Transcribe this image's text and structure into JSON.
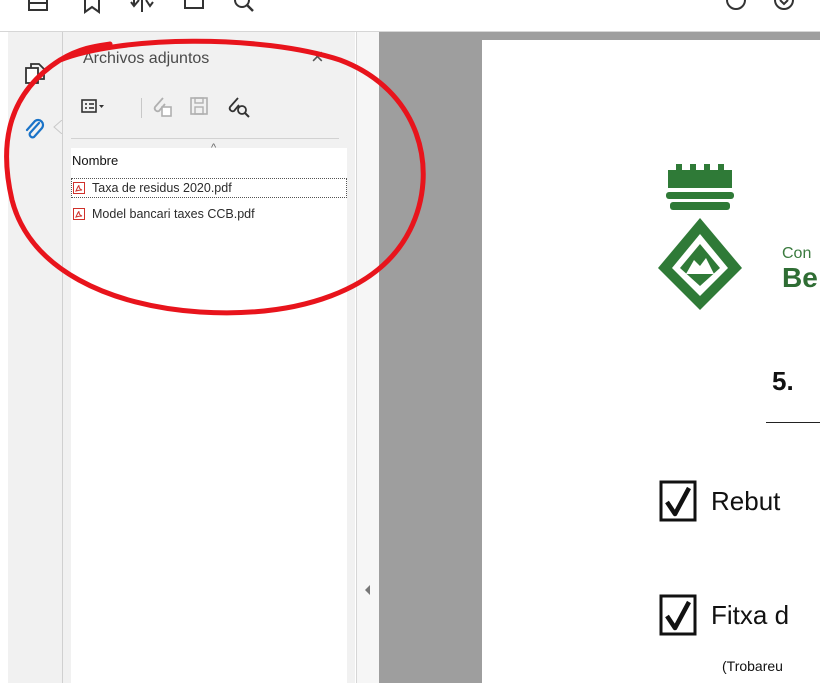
{
  "toolbar": {
    "icons": [
      "home-icon",
      "bookmark-star-icon",
      "share-icon",
      "print-icon",
      "search-icon",
      "help-icon",
      "download-icon"
    ]
  },
  "nav": {
    "icons": [
      "pages-copy-icon",
      "attachment-paperclip-icon"
    ],
    "active": "attachment-paperclip-icon"
  },
  "attachments_panel": {
    "title": "Archivos adjuntos",
    "close_label": "×",
    "tools": [
      "options-list-icon",
      "add-attachment-icon",
      "save-attachment-icon",
      "search-attachment-icon"
    ],
    "sort_indicator": "^",
    "column_header": "Nombre",
    "files": [
      {
        "name": "Taxa de residus 2020.pdf",
        "selected": true
      },
      {
        "name": "Model bancari taxes CCB.pdf",
        "selected": false
      }
    ]
  },
  "document": {
    "org_small": "Con",
    "org_big": "Be",
    "section_number": "5.",
    "checklist": [
      {
        "label": "Rebut"
      },
      {
        "label": "Fitxa d"
      }
    ],
    "note": "(Trobareu"
  },
  "colors": {
    "annotation": "#e8141c",
    "crest_green": "#2f7a37",
    "panel_bg": "#f1f1f1",
    "doc_bg": "#9e9e9e"
  }
}
